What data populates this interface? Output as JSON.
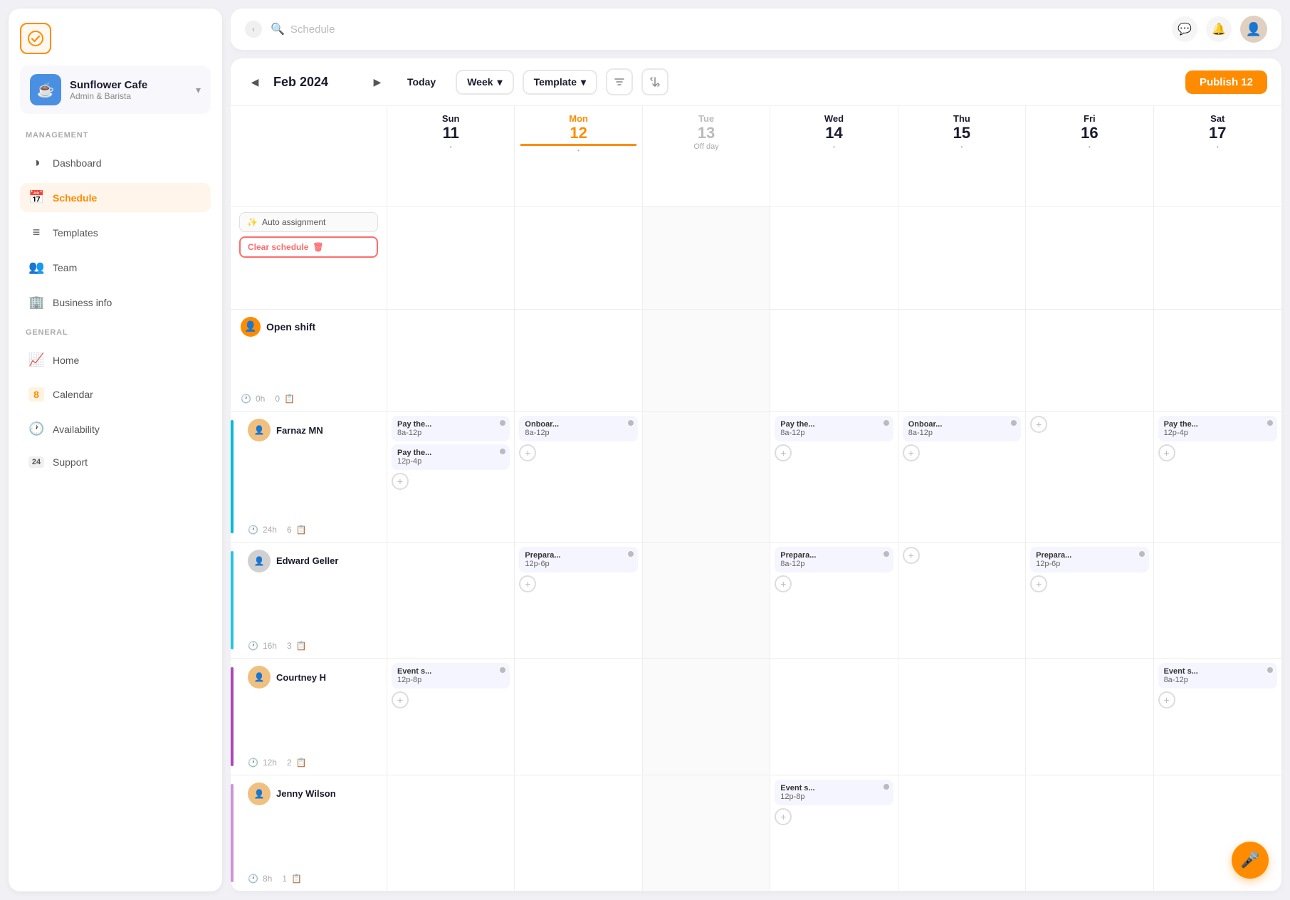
{
  "app": {
    "logo_icon": "✓",
    "search_placeholder": "Schedule"
  },
  "workspace": {
    "name": "Sunflower Cafe",
    "role": "Admin & Barista",
    "icon": "☕"
  },
  "sidebar": {
    "management_label": "MANAGEMENT",
    "general_label": "GENERAL",
    "management_items": [
      {
        "id": "dashboard",
        "label": "Dashboard",
        "icon": "◑"
      },
      {
        "id": "schedule",
        "label": "Schedule",
        "icon": "📅",
        "active": true
      },
      {
        "id": "templates",
        "label": "Templates",
        "icon": "≡"
      },
      {
        "id": "team",
        "label": "Team",
        "icon": "👥"
      },
      {
        "id": "business",
        "label": "Business info",
        "icon": "🏢"
      }
    ],
    "general_items": [
      {
        "id": "home",
        "label": "Home",
        "icon": "📈"
      },
      {
        "id": "calendar",
        "label": "Calendar",
        "icon": "8"
      },
      {
        "id": "availability",
        "label": "Availability",
        "icon": "🕐"
      },
      {
        "id": "support",
        "label": "Support",
        "icon": "24"
      }
    ]
  },
  "schedule": {
    "month_label": "Feb 2024",
    "today_label": "Today",
    "week_label": "Week",
    "template_label": "Template",
    "publish_label": "Publish 12",
    "auto_assignment_label": "Auto assignment",
    "clear_schedule_label": "Clear schedule",
    "days": [
      {
        "name": "Sun",
        "num": "11",
        "today": false,
        "off": false
      },
      {
        "name": "Mon",
        "num": "12",
        "today": false,
        "off": false
      },
      {
        "name": "Tue",
        "num": "13",
        "today": false,
        "off": true,
        "off_label": "Off day"
      },
      {
        "name": "Wed",
        "num": "14",
        "today": false,
        "off": false
      },
      {
        "name": "Thu",
        "num": "15",
        "today": false,
        "off": false
      },
      {
        "name": "Fri",
        "num": "16",
        "today": false,
        "off": false
      },
      {
        "name": "Sat",
        "num": "17",
        "today": false,
        "off": false
      }
    ],
    "open_shift": {
      "label": "Open shift",
      "hours": "0h",
      "count": "0"
    },
    "employees": [
      {
        "name": "Farnaz MN",
        "color": "#00bcd4",
        "hours": "24h",
        "shifts_count": "6",
        "avatar": "F",
        "shifts": {
          "sun": [
            {
              "title": "Pay the...",
              "time": "8a-12p"
            },
            {
              "title": "Pay the...",
              "time": "12p-4p"
            }
          ],
          "mon": [
            {
              "title": "Onboar...",
              "time": "8a-12p"
            }
          ],
          "tue": [],
          "wed": [
            {
              "title": "Pay the...",
              "time": "8a-12p"
            }
          ],
          "thu": [
            {
              "title": "Onboar...",
              "time": "8a-12p"
            }
          ],
          "fri": [],
          "sat": [
            {
              "title": "Pay the...",
              "time": "12p-4p"
            }
          ]
        }
      },
      {
        "name": "Edward Geller",
        "color": "#26c6da",
        "hours": "16h",
        "shifts_count": "3",
        "avatar": "E",
        "shifts": {
          "sun": [],
          "mon": [
            {
              "title": "Prepara...",
              "time": "12p-6p"
            }
          ],
          "tue": [],
          "wed": [
            {
              "title": "Prepara...",
              "time": "8a-12p"
            }
          ],
          "thu": [],
          "fri": [
            {
              "title": "Prepara...",
              "time": "12p-6p"
            }
          ],
          "sat": []
        }
      },
      {
        "name": "Courtney H",
        "color": "#ab47bc",
        "hours": "12h",
        "shifts_count": "2",
        "avatar": "C",
        "shifts": {
          "sun": [
            {
              "title": "Event s...",
              "time": "12p-8p"
            }
          ],
          "mon": [],
          "tue": [],
          "wed": [],
          "thu": [],
          "fri": [],
          "sat": [
            {
              "title": "Event s...",
              "time": "8a-12p"
            }
          ]
        }
      },
      {
        "name": "Jenny Wilson",
        "color": "#ce93d8",
        "hours": "8h",
        "shifts_count": "1",
        "avatar": "J",
        "shifts": {
          "sun": [],
          "mon": [],
          "tue": [],
          "wed": [
            {
              "title": "Event s...",
              "time": "12p-8p"
            }
          ],
          "thu": [],
          "fri": [],
          "sat": []
        }
      }
    ]
  }
}
